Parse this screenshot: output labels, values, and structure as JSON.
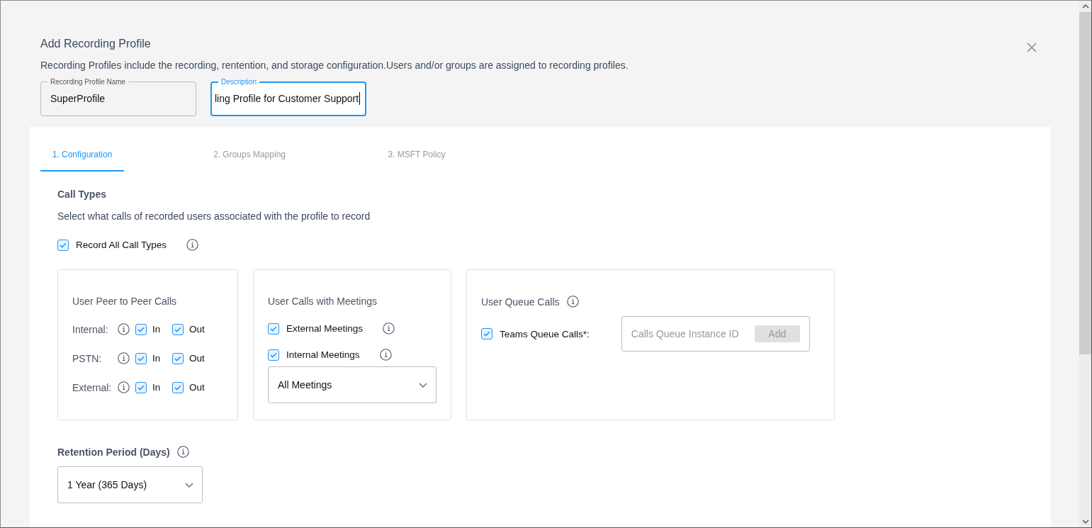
{
  "dialog": {
    "title": "Add Recording Profile",
    "subtitle": "Recording Profiles include the recording, rentention, and storage configuration.Users and/or groups are assigned to recording profiles."
  },
  "fields": [
    {
      "label": "Recording Profile Name",
      "value": "SuperProfile",
      "focused": false
    },
    {
      "label": "Description",
      "value": "ling Profile for Customer Support",
      "focused": true
    }
  ],
  "tabs": [
    {
      "label": "1. Configuration",
      "selected": true
    },
    {
      "label": "2. Groups Mapping",
      "selected": false
    },
    {
      "label": "3. MSFT Policy",
      "selected": false
    }
  ],
  "call_types": {
    "title": "Call Types",
    "description": "Select what calls of recorded users associated with the profile to record",
    "record_all": {
      "label": "Record All Call Types",
      "checked": true
    }
  },
  "peer_calls": {
    "title": "User Peer to Peer Calls",
    "rows": [
      {
        "label": "Internal:",
        "in": {
          "label": "In",
          "checked": true
        },
        "out": {
          "label": "Out",
          "checked": true
        }
      },
      {
        "label": "PSTN:",
        "in": {
          "label": "In",
          "checked": true
        },
        "out": {
          "label": "Out",
          "checked": true
        }
      },
      {
        "label": "External:",
        "in": {
          "label": "In",
          "checked": true
        },
        "out": {
          "label": "Out",
          "checked": true
        }
      }
    ]
  },
  "meeting_calls": {
    "title": "User Calls with Meetings",
    "options": [
      {
        "label": "External Meetings",
        "checked": true
      },
      {
        "label": "Internal Meetings",
        "checked": true
      }
    ],
    "select": {
      "value": "All Meetings"
    }
  },
  "queue_calls": {
    "title": "User Queue Calls",
    "option": {
      "label": "Teams Queue Calls*:",
      "checked": true
    },
    "input": {
      "placeholder": "Calls Queue Instance ID"
    },
    "add_button": {
      "label": "Add",
      "disabled": true
    }
  },
  "retention": {
    "label": "Retention Period (Days)",
    "select": {
      "value": "1 Year (365 Days)"
    }
  }
}
